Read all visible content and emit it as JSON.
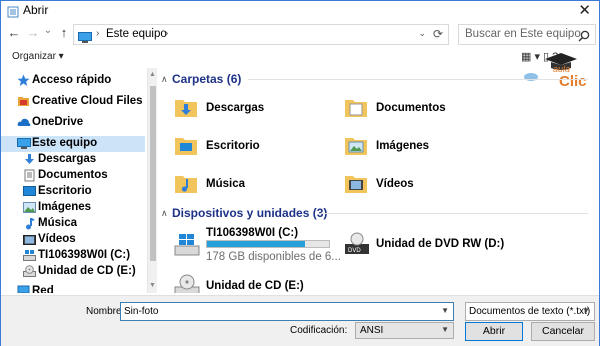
{
  "window": {
    "title": "Abrir",
    "close": "✕"
  },
  "nav": {
    "back": "←",
    "forward": "→",
    "dropdown": "⌄",
    "up": "↑"
  },
  "address": {
    "crumb": "Este equipo",
    "sep": "›",
    "dropdown": "⌄",
    "refresh": "⟳"
  },
  "search": {
    "placeholder": "Buscar en Este equipo"
  },
  "toolbar": {
    "organize": "Organizar ▾",
    "view_icons": "▦ ▾  ▯  ?"
  },
  "brand": {
    "top": "aula",
    "bottom": "Clic"
  },
  "sidebar": {
    "items": [
      {
        "label": "Acceso rápido",
        "icon": "star-icon"
      },
      {
        "label": "Creative Cloud Files",
        "icon": "creative-cloud-icon"
      },
      {
        "label": "OneDrive",
        "icon": "onedrive-icon"
      },
      {
        "label": "Este equipo",
        "icon": "computer-icon"
      },
      {
        "label": "Descargas",
        "icon": "download-icon"
      },
      {
        "label": "Documentos",
        "icon": "documents-icon"
      },
      {
        "label": "Escritorio",
        "icon": "desktop-icon"
      },
      {
        "label": "Imágenes",
        "icon": "pictures-icon"
      },
      {
        "label": "Música",
        "icon": "music-icon"
      },
      {
        "label": "Vídeos",
        "icon": "videos-icon"
      },
      {
        "label": "TI106398W0I (C:)",
        "icon": "drive-icon"
      },
      {
        "label": "Unidad de CD (E:)",
        "icon": "cd-drive-icon"
      },
      {
        "label": "Red",
        "icon": "network-icon"
      }
    ]
  },
  "main": {
    "folders_header": "Carpetas (6)",
    "folders": [
      "Descargas",
      "Documentos",
      "Escritorio",
      "Imágenes",
      "Música",
      "Vídeos"
    ],
    "devices_header": "Dispositivos y unidades (3)",
    "devices": [
      {
        "label": "TI106398W0I (C:)",
        "sub": "178 GB disponibles de 6...",
        "usage": 0.8
      },
      {
        "label": "Unidad de DVD RW (D:)"
      },
      {
        "label": "Unidad de CD (E:)"
      }
    ]
  },
  "footer": {
    "name_label": "Nombre:",
    "name_value": "Sin-foto",
    "type_value": "Documentos de texto (*.txt)",
    "encoding_label": "Codificación:",
    "encoding_value": "ANSI",
    "open_label": "Abrir",
    "cancel_label": "Cancelar"
  },
  "colors": {
    "accent": "#0078d7",
    "header": "#1e3287",
    "selection": "#cce4f7",
    "folder": "#f2c55c"
  }
}
